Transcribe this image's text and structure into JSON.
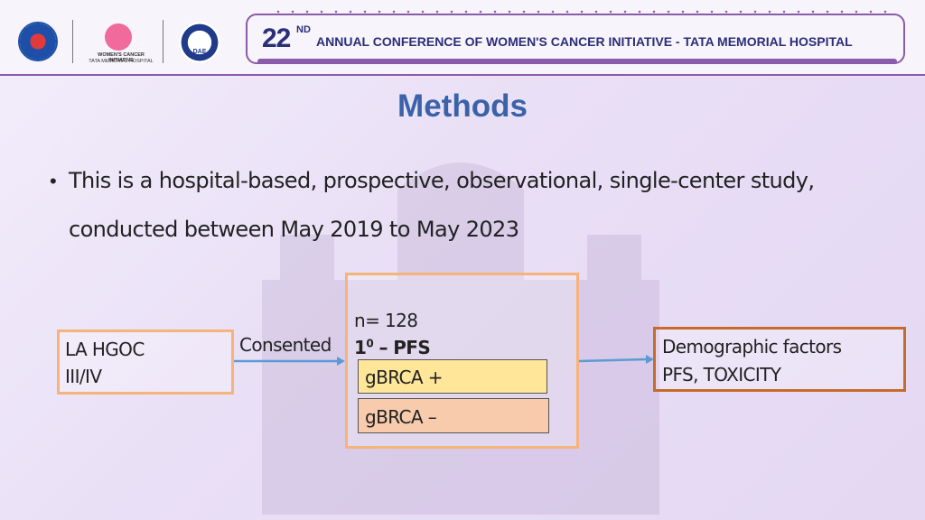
{
  "header": {
    "logo2_line1": "WOMEN'S CANCER INITIATIVE",
    "logo2_line2": "TATA MEMORIAL HOSPITAL",
    "logo3_label": "DAE",
    "banner_number": "22",
    "banner_superscript": "ND",
    "banner_text": "ANNUAL CONFERENCE OF WOMEN'S CANCER INITIATIVE - TATA MEMORIAL HOSPITAL"
  },
  "slide": {
    "title": "Methods",
    "bullet_line1": "This is a hospital-based, prospective, observational, single-center study,",
    "bullet_line2": "conducted between May 2019 to May 2023"
  },
  "flow": {
    "left_line1": "LA HGOC",
    "left_line2": "III/IV",
    "arrow1_label": "Consented",
    "n_label": "n= 128",
    "pfs_base": "1",
    "pfs_sup": "0",
    "pfs_rest": " – PFS",
    "gbrca_pos": "gBRCA +",
    "gbrca_neg": "gBRCA –",
    "right_line1": "Demographic factors",
    "right_line2": "PFS, TOXICITY"
  },
  "colors": {
    "title": "#3a62a8",
    "accent_purple": "#8a5ba8",
    "box_orange": "#f6b37a",
    "box_dark_orange": "#c76b2b",
    "gbrca_pos_fill": "#ffe699",
    "gbrca_neg_fill": "#f8cbad",
    "arrow_blue": "#5b9bd5"
  }
}
